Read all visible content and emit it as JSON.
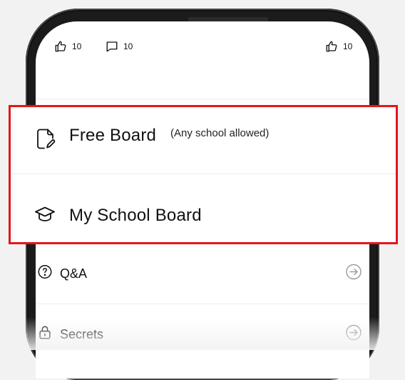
{
  "stats": {
    "likes_count": "10",
    "comments_count": "10",
    "likes_count_right": "10"
  },
  "board_picker": {
    "items": [
      {
        "label": "Free Board",
        "sublabel": "(Any school allowed)",
        "icon": "document-edit-icon"
      },
      {
        "label": "My School Board",
        "icon": "graduation-cap-icon"
      }
    ],
    "highlight_color": "#e3161b"
  },
  "list": {
    "items": [
      {
        "label": "Q&A",
        "icon": "question-circle-icon",
        "trailing_icon": "arrow-right-circle-icon"
      },
      {
        "label": "Secrets",
        "icon": "lock-icon",
        "trailing_icon": "arrow-right-circle-icon"
      }
    ]
  }
}
